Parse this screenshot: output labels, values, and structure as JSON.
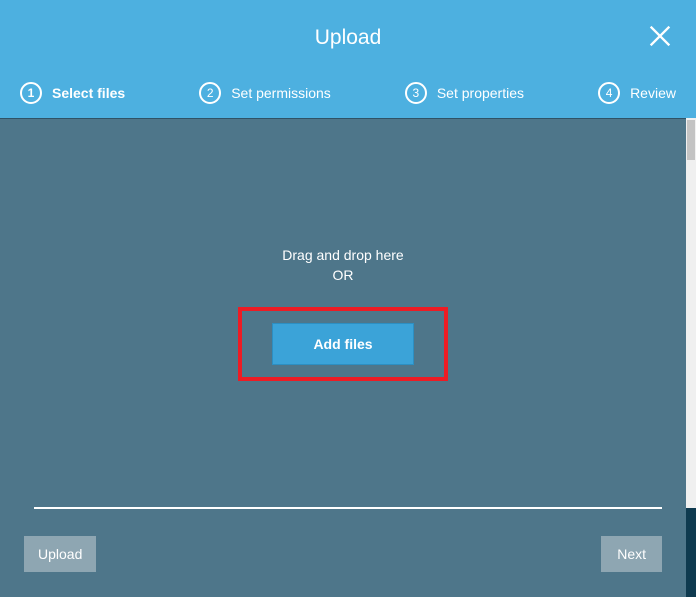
{
  "header": {
    "title": "Upload",
    "close_icon": "close-icon"
  },
  "steps": [
    {
      "num": "1",
      "label": "Select files",
      "active": true
    },
    {
      "num": "2",
      "label": "Set permissions",
      "active": false
    },
    {
      "num": "3",
      "label": "Set properties",
      "active": false
    },
    {
      "num": "4",
      "label": "Review",
      "active": false
    }
  ],
  "drop": {
    "line1": "Drag and drop here",
    "line2": "OR",
    "button": "Add files"
  },
  "footer": {
    "upload": "Upload",
    "next": "Next"
  }
}
